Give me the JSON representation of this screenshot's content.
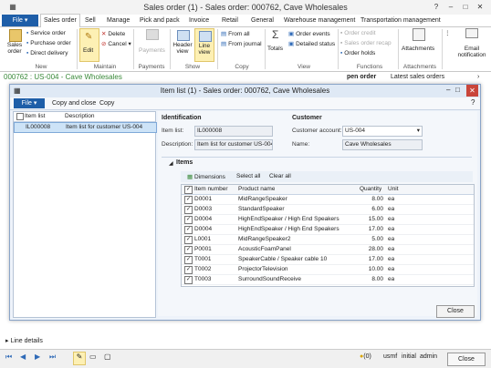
{
  "window": {
    "title": "Sales order (1) - Sales order: 000762, Cave Wholesales"
  },
  "ribbon": {
    "file_label": "File",
    "tabs": [
      "Sales order",
      "Sell",
      "Manage",
      "Pick and pack",
      "Invoice",
      "Retail",
      "General",
      "Warehouse management",
      "Transportation management"
    ],
    "groups": {
      "new": {
        "label": "New",
        "sales_order": "Sales order",
        "service_order": "Service order",
        "purchase_order": "Purchase order",
        "direct_delivery": "Direct delivery"
      },
      "maintain": {
        "label": "Maintain",
        "edit": "Edit",
        "delete": "Delete",
        "cancel": "Cancel"
      },
      "payments": {
        "label": "Payments",
        "payments": "Payments"
      },
      "show": {
        "label": "Show",
        "header_view": "Header view",
        "line_view": "Line view"
      },
      "copy": {
        "label": "Copy",
        "from_all": "From all",
        "from_journal": "From journal"
      },
      "view": {
        "label": "View",
        "totals": "Totals",
        "order_events": "Order events",
        "detailed_status": "Detailed status"
      },
      "functions": {
        "label": "Functions",
        "order_credit": "Order credit",
        "sales_order_recap": "Sales order recap",
        "order_holds": "Order holds"
      },
      "attachments": {
        "label": "Attachments",
        "attachments": "Attachments"
      },
      "email": {
        "label": "Email notification"
      }
    }
  },
  "record": {
    "title": "000762 : US-004 - Cave Wholesales",
    "open_order": "pen order",
    "latest_sales_orders": "Latest sales orders"
  },
  "dialog": {
    "title": "Item list (1) - Sales order: 000762, Cave Wholesales",
    "toolbar": {
      "file": "File",
      "copy_and_close": "Copy and close",
      "copy": "Copy"
    },
    "list": {
      "headers": [
        "Item list",
        "Description"
      ],
      "rows": [
        {
          "item_list": "IL000008",
          "description": "Item list for customer US-004"
        }
      ]
    },
    "identification": {
      "header": "Identification",
      "item_list_label": "Item list:",
      "item_list_value": "IL000008",
      "description_label": "Description:",
      "description_value": "Item list for customer US-004"
    },
    "customer": {
      "header": "Customer",
      "account_label": "Customer account:",
      "account_value": "US-004",
      "name_label": "Name:",
      "name_value": "Cave Wholesales"
    },
    "items": {
      "header": "Items",
      "dimensions": "Dimensions",
      "select_all": "Select all",
      "clear_all": "Clear all",
      "columns": [
        "Item number",
        "Product name",
        "Quantity",
        "Unit"
      ],
      "rows": [
        {
          "item": "D0001",
          "name": "MidRangeSpeaker",
          "qty": "8.00",
          "unit": "ea"
        },
        {
          "item": "D0003",
          "name": "StandardSpeaker",
          "qty": "6.00",
          "unit": "ea"
        },
        {
          "item": "D0004",
          "name": "HighEndSpeaker / High End Speakers",
          "qty": "15.00",
          "unit": "ea"
        },
        {
          "item": "D0004",
          "name": "HighEndSpeaker / High End Speakers",
          "qty": "17.00",
          "unit": "ea"
        },
        {
          "item": "L0001",
          "name": "MidRangeSpeaker2",
          "qty": "5.00",
          "unit": "ea"
        },
        {
          "item": "P0001",
          "name": "AcousticFoamPanel",
          "qty": "28.00",
          "unit": "ea"
        },
        {
          "item": "T0001",
          "name": "SpeakerCable / Speaker cable 10",
          "qty": "17.00",
          "unit": "ea"
        },
        {
          "item": "T0002",
          "name": "ProjectorTelevision",
          "qty": "10.00",
          "unit": "ea"
        },
        {
          "item": "T0003",
          "name": "SurroundSoundReceive",
          "qty": "8.00",
          "unit": "ea"
        }
      ]
    },
    "close": "Close"
  },
  "line_details": "Line details",
  "statusbar": {
    "count": "(0)",
    "company": "usmf",
    "initial": "initial",
    "user": "admin",
    "close": "Close"
  },
  "colors": {
    "file_blue": "#1e5ea8",
    "header_green": "#3a8a3a",
    "active_view": "#fdf0b4"
  }
}
